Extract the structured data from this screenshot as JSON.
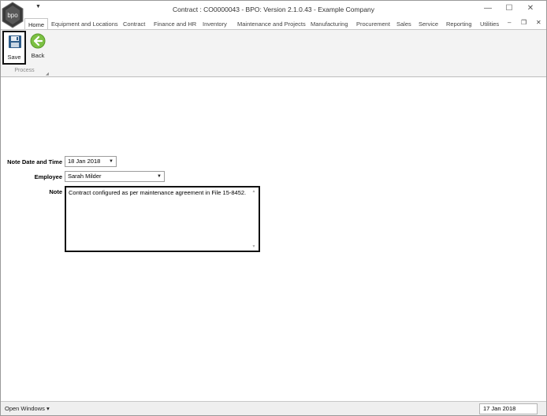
{
  "window": {
    "title": "Contract : CO0000043 - BPO: Version 2.1.0.43 - Example Company",
    "logo_text": "bpo",
    "controls": {
      "minimize": "—",
      "maximize": "☐",
      "close": "✕"
    }
  },
  "tabs": [
    {
      "label": "Home"
    },
    {
      "label": "Equipment and Locations"
    },
    {
      "label": "Contract"
    },
    {
      "label": "Finance and HR"
    },
    {
      "label": "Inventory"
    },
    {
      "label": "Maintenance and Projects"
    },
    {
      "label": "Manufacturing"
    },
    {
      "label": "Procurement"
    },
    {
      "label": "Sales"
    },
    {
      "label": "Service"
    },
    {
      "label": "Reporting"
    },
    {
      "label": "Utilities"
    }
  ],
  "tab_controls": {
    "minimize": "–",
    "restore": "❐",
    "close": "✕"
  },
  "ribbon": {
    "save_label": "Save",
    "back_label": "Back",
    "group_label": "Process"
  },
  "form": {
    "note_date_label": "Note Date and Time",
    "note_date_value": "18 Jan 2018",
    "employee_label": "Employee",
    "employee_value": "Sarah Milder",
    "note_label": "Note",
    "note_value": "Contract configured as per maintenance agreement in File 15-8452."
  },
  "statusbar": {
    "open_windows_label": "Open Windows ▾",
    "date": "17 Jan 2018"
  }
}
